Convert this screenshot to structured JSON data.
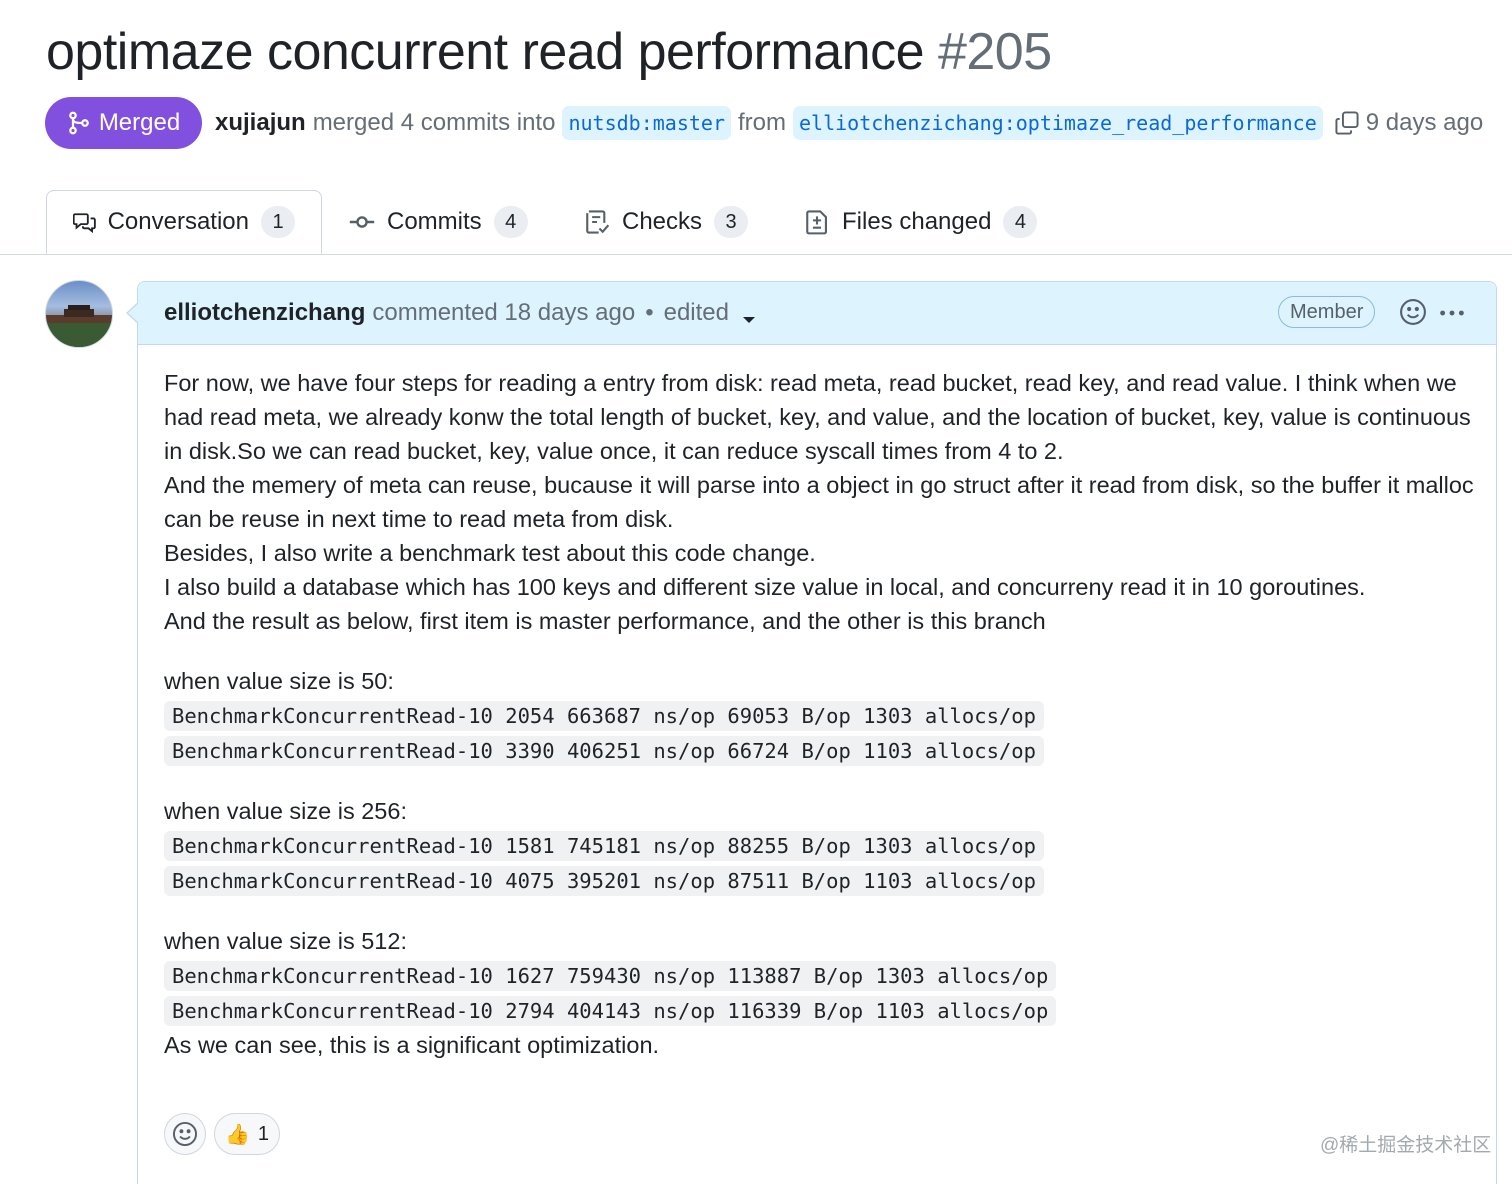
{
  "pr": {
    "title": "optimaze concurrent read performance",
    "number": "#205",
    "state": "Merged",
    "author": "xujiajun",
    "summary": "merged 4 commits into",
    "base_branch": "nutsdb:master",
    "from_text": "from",
    "head_branch": "elliotchenzichang:optimaze_read_performance",
    "time": "9 days ago"
  },
  "tabs": [
    {
      "label": "Conversation",
      "count": "1",
      "icon": "comment-discussion-icon"
    },
    {
      "label": "Commits",
      "count": "4",
      "icon": "git-commit-icon"
    },
    {
      "label": "Checks",
      "count": "3",
      "icon": "checklist-icon"
    },
    {
      "label": "Files changed",
      "count": "4",
      "icon": "file-diff-icon"
    }
  ],
  "comment": {
    "author": "elliotchenzichang",
    "action": "commented 18 days ago",
    "separator": "•",
    "edited": "edited",
    "role": "Member",
    "intro": [
      "For now, we have four steps for reading a entry from disk: read meta, read bucket, read key, and read value. I think when we had read meta, we already konw the total length of bucket, key, and value, and the location of bucket, key, value is continuous in disk.So we can read bucket, key, value once, it can reduce syscall times from 4 to 2.",
      "And the memery of meta can reuse, bucause it will parse into a object in go struct after it read from disk, so the buffer it malloc can be reuse in next time to read meta from disk.",
      "Besides, I also write a benchmark test about this code change.",
      "I also build a database which has 100 keys and different size value in local, and concurreny read it in 10 goroutines.",
      "And the result as below, first item is master performance, and the other is this branch"
    ],
    "benchmarks": [
      {
        "heading": "when value size is 50:",
        "lines": [
          "BenchmarkConcurrentRead-10 2054 663687 ns/op 69053 B/op 1303 allocs/op",
          "BenchmarkConcurrentRead-10 3390 406251 ns/op 66724 B/op 1103 allocs/op"
        ]
      },
      {
        "heading": "when value size is 256:",
        "lines": [
          "BenchmarkConcurrentRead-10 1581 745181 ns/op 88255 B/op 1303 allocs/op",
          "BenchmarkConcurrentRead-10 4075 395201 ns/op 87511 B/op 1103 allocs/op"
        ]
      },
      {
        "heading": "when value size is 512:",
        "lines": [
          "BenchmarkConcurrentRead-10 1627 759430 ns/op 113887 B/op 1303 allocs/op",
          "BenchmarkConcurrentRead-10 2794 404143 ns/op 116339 B/op 1103 allocs/op"
        ]
      }
    ],
    "conclusion": "As we can see, this is a significant optimization.",
    "reactions": [
      {
        "emoji": "👍",
        "count": "1"
      }
    ]
  },
  "watermark": "@稀土掘金技术社区",
  "colors": {
    "merged": "#8250df",
    "link": "#0969da",
    "header_bg": "#ddf4ff",
    "border": "#d0d7de"
  }
}
